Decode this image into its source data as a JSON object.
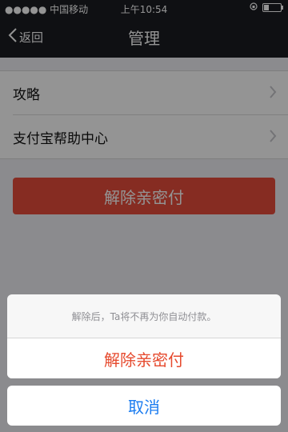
{
  "status_bar": {
    "carrier": "●●●●● 中国移动",
    "time": "上午10:54"
  },
  "navbar": {
    "back_label": "返回",
    "title": "管理"
  },
  "list": {
    "items": [
      {
        "label": "攻略"
      },
      {
        "label": "支付宝帮助中心"
      }
    ]
  },
  "main_button": {
    "label": "解除亲密付"
  },
  "action_sheet": {
    "message": "解除后，Ta将不再为你自动付款。",
    "destructive_label": "解除亲密付",
    "cancel_label": "取消"
  },
  "colors": {
    "nav_bg": "#1b1d22",
    "main_button": "#e74c3c",
    "destructive": "#e64a2e",
    "cancel": "#1b7cf0"
  }
}
